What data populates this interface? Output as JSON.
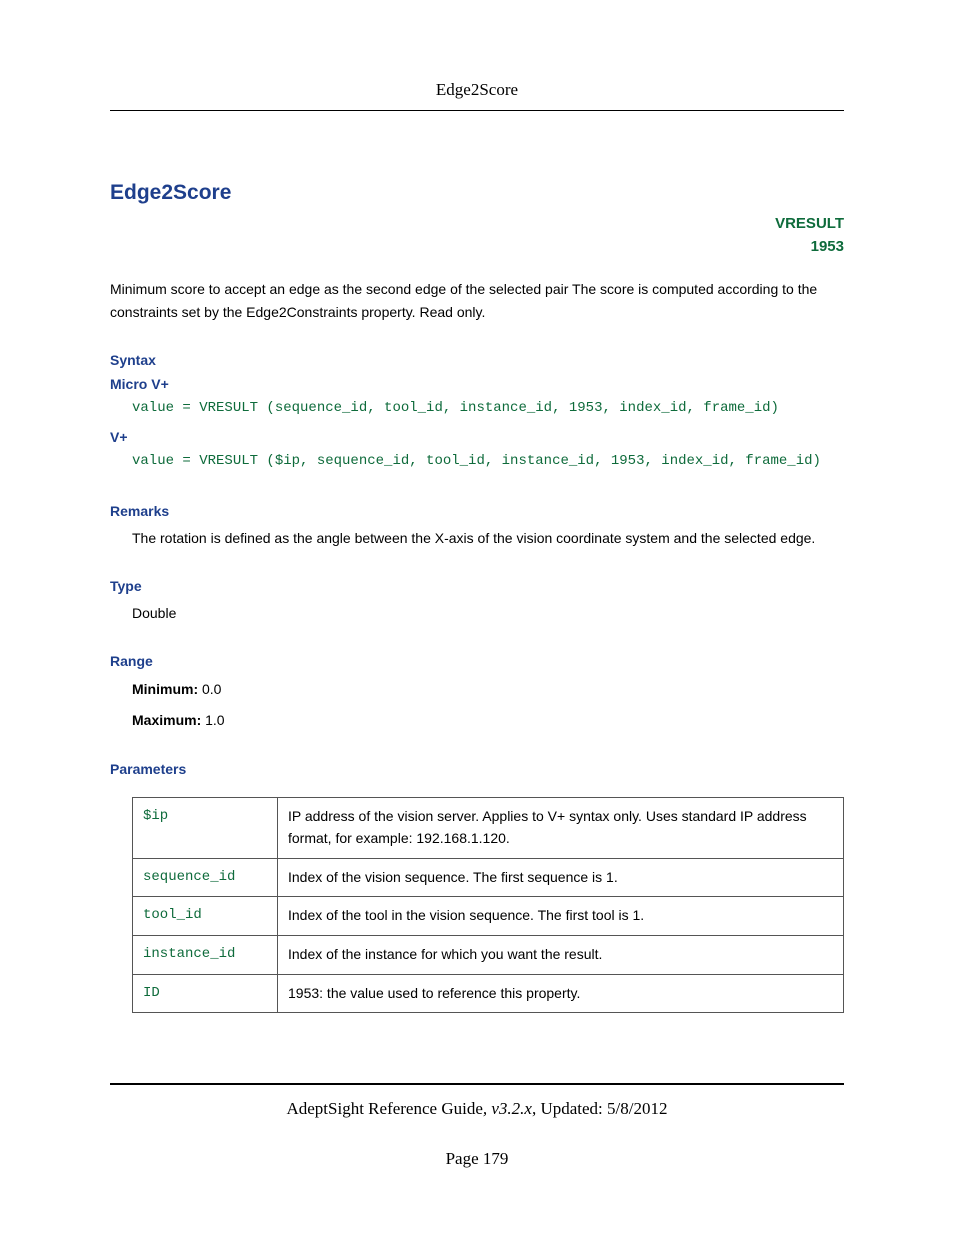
{
  "header": {
    "running": "Edge2Score"
  },
  "title": "Edge2Score",
  "meta": {
    "tag": "VRESULT",
    "code": "1953"
  },
  "intro": "Minimum score to accept an edge as the second edge of the selected pair The score is computed according to the constraints set by the Edge2Constraints property. Read only.",
  "syntax": {
    "heading": "Syntax",
    "microLabel": "Micro V+",
    "microCode": "value = VRESULT (sequence_id, tool_id, instance_id, 1953, index_id, frame_id)",
    "vplusLabel": "V+",
    "vplusCode": "value = VRESULT ($ip, sequence_id, tool_id, instance_id, 1953, index_id, frame_id)"
  },
  "remarks": {
    "heading": "Remarks",
    "text": "The rotation is defined as the angle between the X-axis of the vision coordinate system and the selected edge."
  },
  "type": {
    "heading": "Type",
    "value": "Double"
  },
  "range": {
    "heading": "Range",
    "minLabel": "Minimum:",
    "minVal": "0.0",
    "maxLabel": "Maximum:",
    "maxVal": "1.0"
  },
  "parameters": {
    "heading": "Parameters",
    "rows": [
      {
        "name": "$ip",
        "desc": "IP address of the vision server. Applies to V+ syntax only. Uses standard IP address format, for example: 192.168.1.120."
      },
      {
        "name": "sequence_id",
        "desc": "Index of the vision sequence. The first sequence is 1."
      },
      {
        "name": "tool_id",
        "desc": "Index of the tool in the vision sequence. The first tool is 1."
      },
      {
        "name": "instance_id",
        "desc": "Index of the instance for which you want the result."
      },
      {
        "name": "ID",
        "desc": "1953: the value used to reference this property."
      }
    ]
  },
  "footer": {
    "guide": "AdeptSight Reference Guide",
    "version": "v3.2.x",
    "updatedLabel": "Updated:",
    "updated": "5/8/2012",
    "pageLabel": "Page",
    "pageNum": "179"
  }
}
